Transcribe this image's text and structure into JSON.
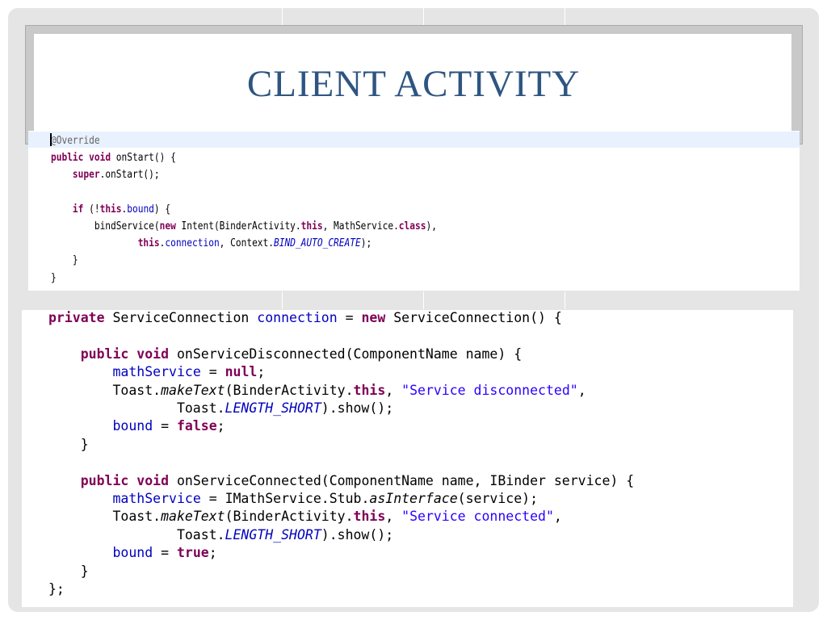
{
  "slide": {
    "title": "CLIENT ACTIVITY",
    "title_color": "#2e5581",
    "background_color": "#e5e5e5"
  },
  "code_snippets": [
    {
      "lines": [
        "@Override",
        "public void onStart() {",
        "    super.onStart();",
        "",
        "    if (!this.bound) {",
        "        bindService(new Intent(BinderActivity.this, MathService.class),",
        "                this.connection, Context.BIND_AUTO_CREATE);",
        "    }",
        "}"
      ]
    },
    {
      "lines": [
        "private ServiceConnection connection = new ServiceConnection() {",
        "",
        "    public void onServiceDisconnected(ComponentName name) {",
        "        mathService = null;",
        "        Toast.makeText(BinderActivity.this, \"Service disconnected\",",
        "                Toast.LENGTH_SHORT).show();",
        "        bound = false;",
        "    }",
        "",
        "    public void onServiceConnected(ComponentName name, IBinder service) {",
        "        mathService = IMathService.Stub.asInterface(service);",
        "        Toast.makeText(BinderActivity.this, \"Service connected\",",
        "                Toast.LENGTH_SHORT).show();",
        "        bound = true;",
        "    }",
        "};"
      ]
    }
  ],
  "syntax_colors": {
    "keyword": "#7f0055",
    "field": "#0000c0",
    "string": "#2a00ff",
    "annotation": "#646464"
  }
}
